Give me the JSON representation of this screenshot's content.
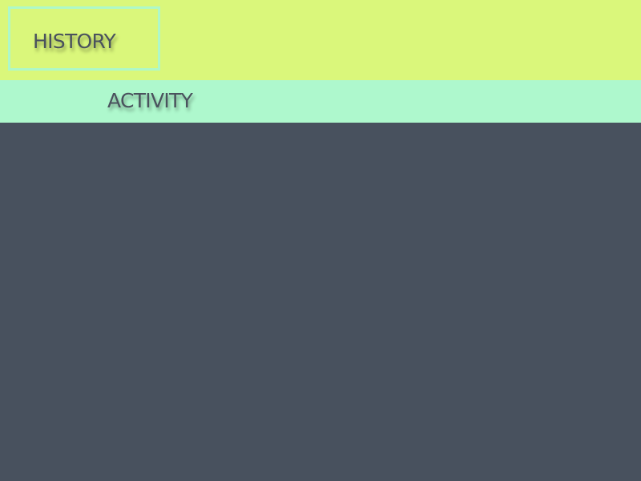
{
  "tabs": {
    "history_label": "HISTORY",
    "activity_label": "ACTIVITY"
  },
  "colors": {
    "top_bar": "#daf77b",
    "activity_bar": "#aef8cd",
    "content_background": "#48515e",
    "tab_border": "#aef8c9",
    "text": "#4a525d"
  }
}
